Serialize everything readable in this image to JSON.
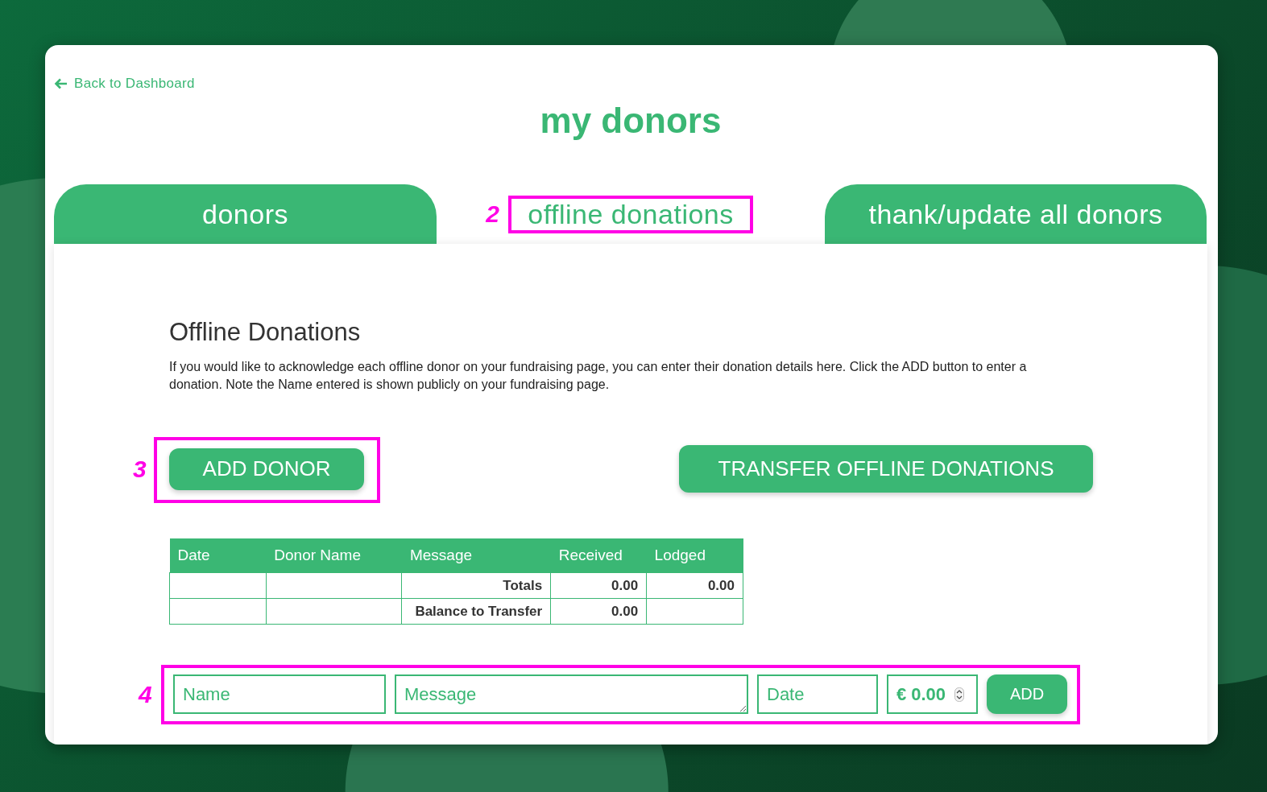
{
  "back_link": "Back to Dashboard",
  "title": "my donors",
  "tabs": [
    {
      "label": "donors",
      "selected": false
    },
    {
      "label": "offline donations",
      "selected": true,
      "callout": "2"
    },
    {
      "label": "thank/update all donors",
      "selected": false
    }
  ],
  "section": {
    "heading": "Offline Donations",
    "description": "If you would like to acknowledge each offline donor on your fundraising page, you can enter their donation details here. Click the ADD button to enter a donation. Note the Name entered is shown publicly on your fundraising page."
  },
  "buttons": {
    "add_donor": {
      "label": "ADD DONOR",
      "callout": "3"
    },
    "transfer": {
      "label": "TRANSFER OFFLINE DONATIONS"
    }
  },
  "table": {
    "columns": [
      "Date",
      "Donor Name",
      "Message",
      "Received",
      "Lodged"
    ],
    "rows": [
      {
        "label": "Totals",
        "received": "0.00",
        "lodged": "0.00"
      },
      {
        "label": "Balance to Transfer",
        "received": "0.00"
      }
    ]
  },
  "form": {
    "callout": "4",
    "fields": [
      {
        "kind": "text",
        "placeholder": "Name"
      },
      {
        "kind": "textarea",
        "placeholder": "Message"
      },
      {
        "kind": "text",
        "placeholder": "Date"
      },
      {
        "kind": "amount",
        "currency": "€",
        "value": "0.00"
      }
    ],
    "submit": "ADD"
  }
}
